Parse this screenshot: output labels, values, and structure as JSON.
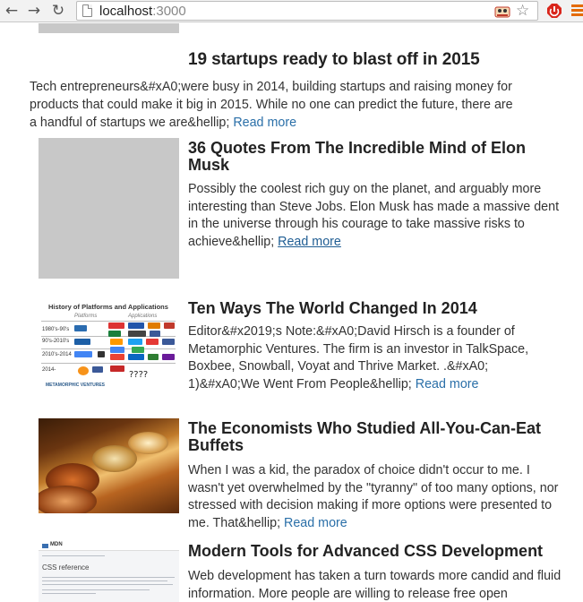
{
  "browser": {
    "url_host": "localhost",
    "url_port": ":3000",
    "back_glyph": "←",
    "forward_glyph": "→",
    "reload_glyph": "↻",
    "star_glyph": "☆"
  },
  "featured": {
    "title": "19 startups ready to blast off in 2015",
    "excerpt": "Tech entrepreneurs&#xA0;were busy in 2014, building startups and raising money for products that could make it big in 2015. While no one can predict the future, there are a handful of startups we are&hellip; ",
    "read_more": "Read more"
  },
  "posts": [
    {
      "title": "36 Quotes From The Incredible Mind of Elon Musk",
      "excerpt": "Possibly the coolest rich guy on the planet, and arguably more interesting than Steve Jobs. Elon Musk has made a massive dent in the universe through his courage to take massive risks to achieve&hellip; ",
      "read_more": "Read more"
    },
    {
      "title": "Ten Ways The World Changed In 2014",
      "excerpt": "Editor&#x2019;s Note:&#xA0;David Hirsch is a founder of Metamorphic Ventures. The firm is an investor in TalkSpace, Boxbee, Snowball, Voyat and Thrive Market. .&#xA0; 1)&#xA0;We Went From People&hellip; ",
      "read_more": "Read more",
      "thumb": {
        "title": "History of Platforms and Applications",
        "col_platforms": "Platforms",
        "col_applications": "Applications",
        "rows": [
          "1980's-90's",
          "90's-2010's",
          "2010's-2014",
          "2014-"
        ],
        "question": "????",
        "brand": "METAMORPHIC VENTURES"
      }
    },
    {
      "title": "The Economists Who Studied All-You-Can-Eat Buffets",
      "excerpt": "When I was a kid, the paradox of choice didn't occur to me. I wasn't yet overwhelmed by the \"tyranny\" of too many options, nor stressed with decision making if more options were presented to me. That&hellip; ",
      "read_more": "Read more"
    },
    {
      "title": "Modern Tools for Advanced CSS Development",
      "excerpt": "Web development has taken a turn towards more candid and fluid information. More people are willing to release free open",
      "thumb": {
        "brand": "MDN",
        "heading": "CSS reference"
      }
    }
  ],
  "colors": {
    "link": "#2a6fa8",
    "placeholder": "#c8c8c8",
    "menu_accent": "#e46a00"
  }
}
